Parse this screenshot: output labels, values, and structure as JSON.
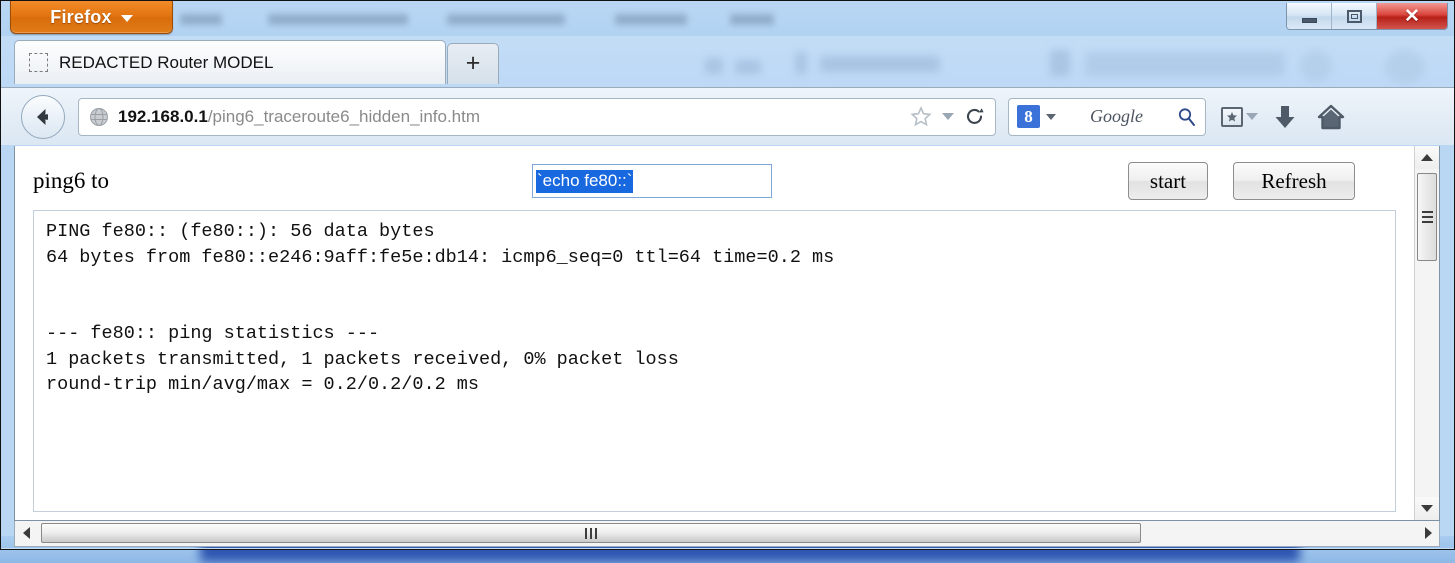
{
  "browser": {
    "app_button_label": "Firefox",
    "window_controls": {
      "minimize": "minimize-button",
      "maximize": "maximize-button",
      "close": "close-button"
    },
    "tabs": [
      {
        "title": "REDACTED Router MODEL",
        "active": true
      }
    ],
    "new_tab_label": "+",
    "address_bar": {
      "host": "192.168.0.1",
      "path": "/ping6_traceroute6_hidden_info.htm",
      "full_url": "192.168.0.1/ping6_traceroute6_hidden_info.htm"
    },
    "search_bar": {
      "engine_initial": "8",
      "engine_label": "Google"
    },
    "icons": {
      "back": "back-arrow-icon",
      "globe": "globe-icon",
      "bookmark_star": "star-icon",
      "bookmark_dropdown": "chevron-down-icon",
      "reload": "reload-icon",
      "search_magnifier": "magnifier-icon",
      "bookmarks_menu": "bookmarks-icon",
      "downloads": "download-arrow-icon",
      "home": "home-icon"
    }
  },
  "page": {
    "ping_label": "ping6 to",
    "ping_input": {
      "value": "`echo fe80::`",
      "placeholder": "",
      "selected": true
    },
    "buttons": {
      "start": "start",
      "refresh": "Refresh"
    },
    "output": "PING fe80:: (fe80::): 56 data bytes\n64 bytes from fe80::e246:9aff:fe5e:db14: icmp6_seq=0 ttl=64 time=0.2 ms\n\n\n--- fe80:: ping statistics ---\n1 packets transmitted, 1 packets received, 0% packet loss\nround-trip min/avg/max = 0.2/0.2/0.2 ms"
  },
  "colors": {
    "firefox_orange": "#e2740f",
    "selection_blue": "#1868e0",
    "close_red": "#b72018",
    "chrome_blue": "#dbe7f3",
    "google_blue": "#3b72d9"
  }
}
